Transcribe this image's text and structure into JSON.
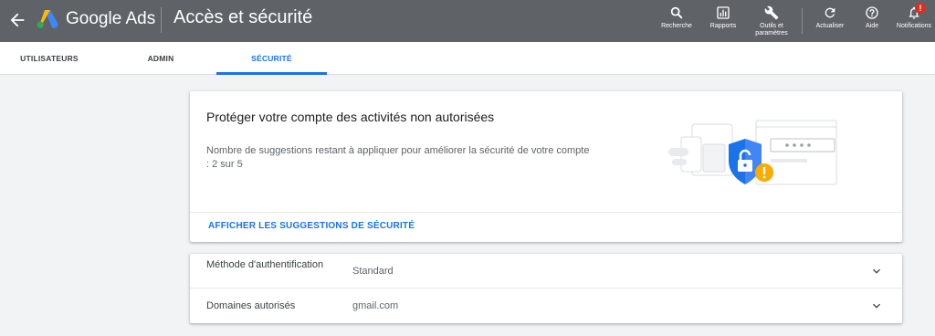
{
  "header": {
    "brand": "Google Ads",
    "title": "Accès et sécurité",
    "tools": [
      {
        "icon": "search-icon",
        "label": "Recherche"
      },
      {
        "icon": "reports-icon",
        "label": "Rapports"
      },
      {
        "icon": "wrench-icon",
        "label_line1": "Outils et",
        "label_line2": "paramètres"
      },
      {
        "icon": "refresh-icon",
        "label": "Actualiser"
      },
      {
        "icon": "help-icon",
        "label": "Aide"
      },
      {
        "icon": "bell-icon",
        "label": "Notifications",
        "badge": "!"
      }
    ]
  },
  "tabs": [
    {
      "label": "UTILISATEURS",
      "active": false
    },
    {
      "label": "ADMIN",
      "active": false
    },
    {
      "label": "SÉCURITÉ",
      "active": true
    }
  ],
  "security_card": {
    "title": "Protéger votre compte des activités non autorisées",
    "description": "Nombre de suggestions restant à appliquer pour améliorer la sécurité de votre compte : 2 sur 5",
    "link": "AFFICHER LES SUGGESTIONS DE SÉCURITÉ"
  },
  "settings": [
    {
      "label": "Méthode d'authentification",
      "value": "Standard"
    },
    {
      "label": "Domaines autorisés",
      "value": "gmail.com"
    }
  ],
  "colors": {
    "header_bg": "#5f6368",
    "accent": "#1a73e8",
    "alert": "#d93025",
    "warning": "#f9ab00"
  }
}
